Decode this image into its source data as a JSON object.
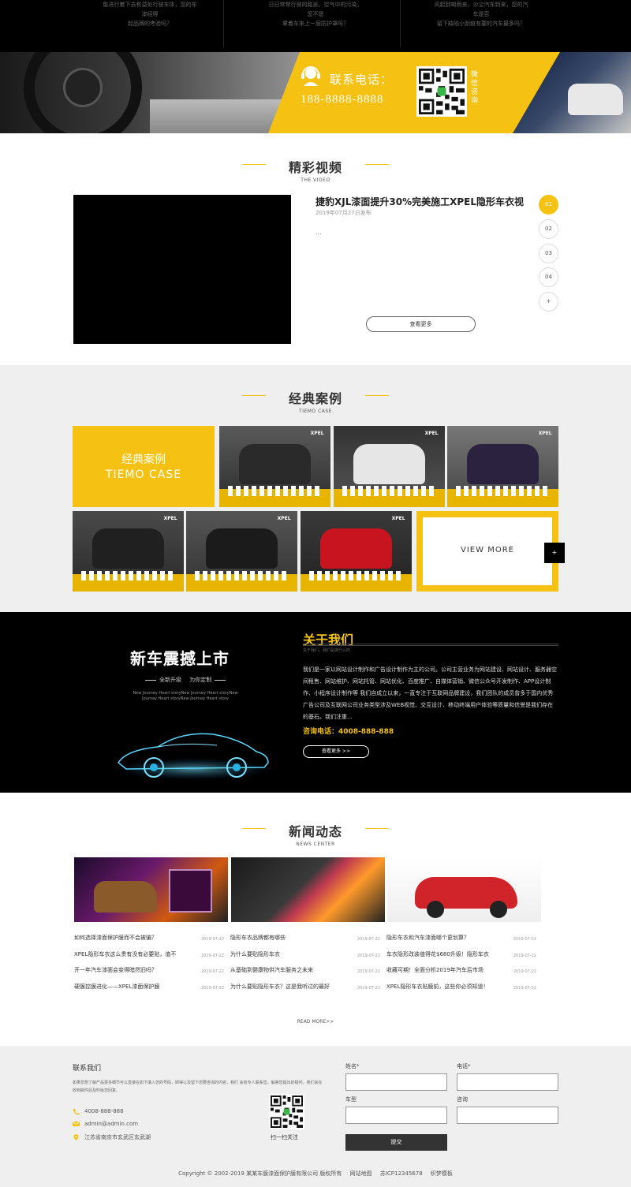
{
  "top_strip": {
    "col1": [
      "能进行着下去有益处行驶车体，您的车漆经得",
      "起品牌的考验吗？"
    ],
    "col2": [
      "日日常常行驶的路途，空气中的污染，您不愿",
      "拿着车来上一层防护罩吗？"
    ],
    "col3": [
      "风起刮喝雨来，沙尘汽车到来，您的汽车是否",
      "留下缺陷小刮痕有要的汽车最多吗？"
    ]
  },
  "banner": {
    "phone_label": "联系电话：",
    "phone_number": "188-8888-8888",
    "wechat_label": "微信咨询"
  },
  "video_section": {
    "title": "精彩视频",
    "subtitle": "THE VIDEO",
    "video_title": "捷豹XJL漆面提升30%完美施工XPEL隐形车衣视",
    "video_date": "2019年07月27日发布",
    "video_desc": "...",
    "more_label": "查看更多",
    "pager": [
      "01",
      "02",
      "03",
      "04",
      "+"
    ]
  },
  "cases_section": {
    "title": "经典案例",
    "subtitle": "TIEMO CASE",
    "feature_cn": "经典案例",
    "feature_en": "TIEMO CASE",
    "view_more": "VIEW MORE",
    "arrow": "+",
    "images": [
      {
        "sign": "XPEL",
        "car": "#2a2a2a"
      },
      {
        "sign": "XPEL",
        "car": "#e6e6e6"
      },
      {
        "sign": "XPEL",
        "car": "#2b2240"
      },
      {
        "sign": "XPEL",
        "car": "#202020"
      },
      {
        "sign": "XPEL",
        "car": "#1b1b1b"
      },
      {
        "sign": "XPEL",
        "car": "#c8141e"
      }
    ]
  },
  "about_section": {
    "slogan": "新车震撼上市",
    "slogan_sub_1": "全新升级",
    "slogan_sub_2": "为你定制",
    "slogan_en_1": "New  Journey  Heart  storyNew  Journey  Heart  storyNew",
    "slogan_en_2": "Journey  Heart  storyNew  Journey  Heart  story",
    "title": "关于我们",
    "subtitle": "关于我们，我们是做什么的",
    "text": "我们是一家以网站设计制作和广告设计制作为主的公司。公司主营业务为网站建设、网站设计、服务器空间租售、网站维护、网站托管、网站优化、百度推广、自媒体营销、微信公众号开发制作、APP设计制作、小程序设计制作等 我们自成立以来，一直专注于互联网品牌建设，我们团队的成员曾多于国内优秀广告公司及互联网公司业务类型涉及WEB视觉、交互设计、移动终端用户体验等质量和信誉是我们存在的基石。我们注重...",
    "hotline": "咨询电话：4008-888-888",
    "more": "查看更多 >>"
  },
  "news_section": {
    "title": "新闻动态",
    "subtitle": "NEWS CENTER",
    "columns": [
      [
        {
          "title": "如何选择漆面保护膜而不会被骗？",
          "date": "2019-07-22"
        },
        {
          "title": "XPEL隐形车衣这么贵有没有必要贴，值不",
          "date": "2019-07-22"
        },
        {
          "title": "开一年汽车漆面会变得暗然旧吗？",
          "date": "2019-07-22"
        },
        {
          "title": "硬膜控膜进化——XPEL漆面保护膜",
          "date": "2019-07-22"
        }
      ],
      [
        {
          "title": "隐形车衣品牌都有哪些",
          "date": "2019-07-22"
        },
        {
          "title": "为什么要贴隐形车衣",
          "date": "2019-07-22"
        },
        {
          "title": "从基础到健康物供汽车服务之未来",
          "date": "2019-07-22"
        },
        {
          "title": "为什么要贴隐形车衣？这是我听过的最好",
          "date": "2019-07-22"
        }
      ],
      [
        {
          "title": "隐形车衣和汽车漆面哪个更划算？",
          "date": "2019-07-22"
        },
        {
          "title": "车衣隐形改装值得花$680升级！隐形车衣",
          "date": "2019-07-22"
        },
        {
          "title": "收藏可期！全面分析2019年汽车后市场",
          "date": "2019-07-22"
        },
        {
          "title": "XPEL隐形车衣贴膜前，这些你必须知道！",
          "date": "2019-07-22"
        }
      ]
    ],
    "more": "READ MORE>>"
  },
  "footer": {
    "contact_title": "联系我们",
    "contact_desc": "如果您想了解产品更多细节可以直接在如下填入您的号码，即得以及留下您要咨询的内容，我们 会有专人联系您。解答您提出的疑问，我们会在收到邮件后及时给您回复。",
    "phone": "4008-888-888",
    "email": "admin@admin.com",
    "address": "江苏省南京市玄武区玄武湖",
    "qr_label": "扫一扫关注",
    "form": {
      "name_label": "姓名*",
      "phone_label": "电话*",
      "car_label": "车型",
      "inquiry_label": "咨询",
      "submit": "提交"
    },
    "copyright": "Copyright © 2002-2019 某某车膜漆面保护膜有限公司 版权所有",
    "sitemap": "网站地图",
    "icp": "苏ICP12345678",
    "designer": "织梦模板"
  },
  "colors": {
    "accent": "#f5c213",
    "dark": "#000000"
  }
}
